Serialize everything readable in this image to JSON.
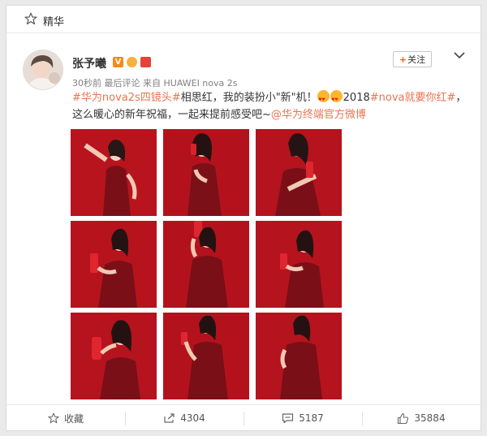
{
  "topbar": {
    "label": "精华"
  },
  "user": {
    "name": "张予曦",
    "badge_v": "V"
  },
  "meta": {
    "time": "30秒前",
    "source": "最后评论 来自 HUAWEI nova 2s"
  },
  "follow": {
    "plus": "+",
    "label": "关注"
  },
  "post": {
    "tag1": "#华为nova2s四镜头#",
    "t1": "相思红，我的装扮小\"新\"机！",
    "t2": "2018",
    "tag2": "#nova就要你红#",
    "t3": "，这么暖心的新年祝福，一起来提前感受吧~",
    "mention": "@华为终端官方微博"
  },
  "actions": {
    "favorite_label": "收藏",
    "repost_count": "4304",
    "comment_count": "5187",
    "like_count": "35884"
  },
  "colors": {
    "accent": "#eb7350",
    "photo_red": "#b5141e"
  }
}
